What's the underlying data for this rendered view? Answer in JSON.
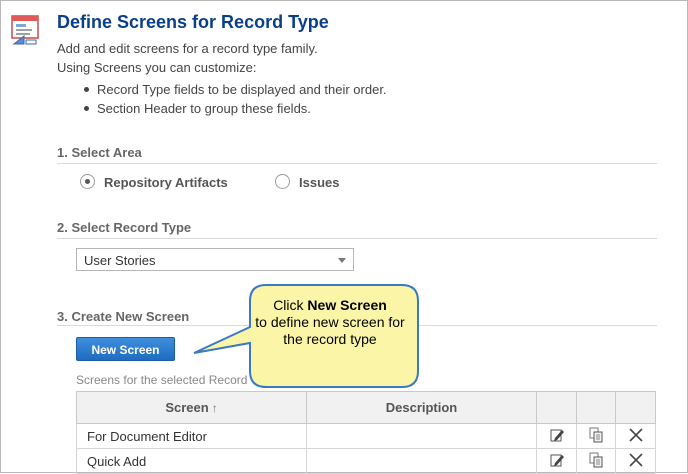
{
  "header": {
    "icon": "screen-layout-icon",
    "title": "Define Screens for Record Type",
    "description_1": "Add and edit screens for a record type family.",
    "description_2": "Using Screens you can customize:",
    "bullets": [
      "Record Type fields to be displayed and their order.",
      "Section Header to group these fields."
    ]
  },
  "section_area": {
    "label": "1. Select Area",
    "options": [
      {
        "label": "Repository Artifacts",
        "selected": true
      },
      {
        "label": "Issues",
        "selected": false
      }
    ]
  },
  "section_record_type": {
    "label": "2. Select Record Type",
    "selected_value": "User Stories"
  },
  "section_new_screen": {
    "label": "3. Create New Screen",
    "button_label": "New Screen",
    "table_caption": "Screens for the selected Record Type",
    "columns": [
      "Screen",
      "Description"
    ],
    "rows": [
      {
        "screen": "For Document Editor",
        "description": ""
      },
      {
        "screen": "Quick Add",
        "description": ""
      }
    ]
  },
  "callout": {
    "prefix": "Click ",
    "emphasis": "New Screen",
    "suffix": "to define new screen for the record type"
  },
  "colors": {
    "title": "#0a3f8a",
    "button": "#2a7ccf",
    "callout_fill": "#fbf6a7",
    "callout_border": "#3a79c4"
  }
}
